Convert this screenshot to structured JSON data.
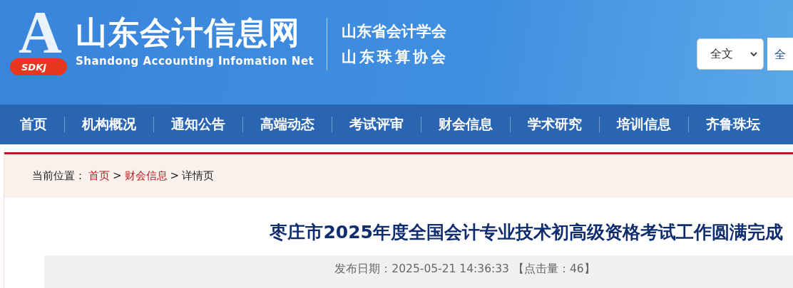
{
  "header": {
    "logo_letter": "A",
    "logo_badge": "SDKJ",
    "site_title": "山东会计信息网",
    "site_subtitle": "Shandong Accounting Infomation Net",
    "partners": [
      "山东省会计学会",
      "山东珠算协会"
    ],
    "search": {
      "scope": "全文",
      "placeholder": "全"
    }
  },
  "nav": [
    {
      "label": "首页"
    },
    {
      "label": "机构概况"
    },
    {
      "label": "通知公告"
    },
    {
      "label": "高端动态"
    },
    {
      "label": "考试评审"
    },
    {
      "label": "财会信息"
    },
    {
      "label": "学术研究"
    },
    {
      "label": "培训信息"
    },
    {
      "label": "齐鲁珠坛"
    }
  ],
  "breadcrumb": {
    "prefix": "当前位置：",
    "links": [
      "首页",
      "财会信息"
    ],
    "separator": ">",
    "current": "详情页"
  },
  "article": {
    "title": "枣庄市2025年度全国会计专业技术初高级资格考试工作圆满完成",
    "meta": "发布日期：2025-05-21 14:36:33 【点击量：46】"
  }
}
